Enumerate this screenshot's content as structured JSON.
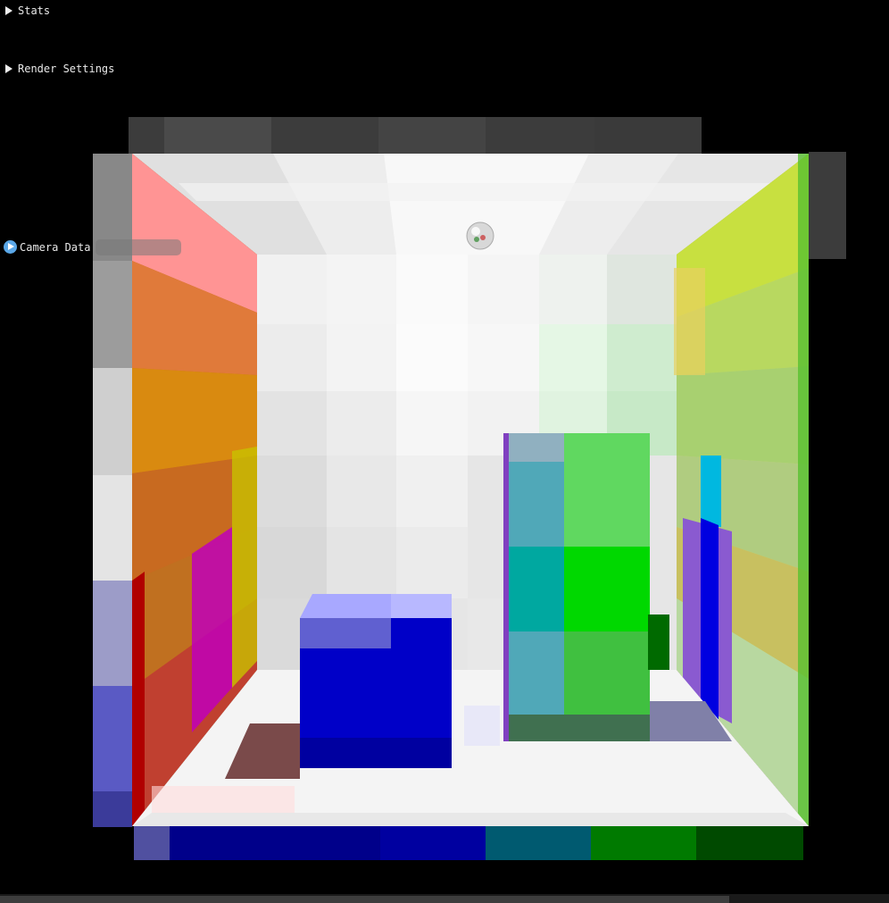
{
  "panels": {
    "stats": {
      "label": "Stats",
      "expanded": false
    },
    "render_settings": {
      "label": "Render Settings",
      "expanded": false
    },
    "camera_data": {
      "label": "Camera Data",
      "expanded": false
    }
  },
  "scene": {
    "description_icon": "voxel-cornell-box",
    "light_icon": "light-probe-sphere-icon"
  },
  "scrollbar": {
    "position": 0.0,
    "visible_fraction": 0.82
  }
}
